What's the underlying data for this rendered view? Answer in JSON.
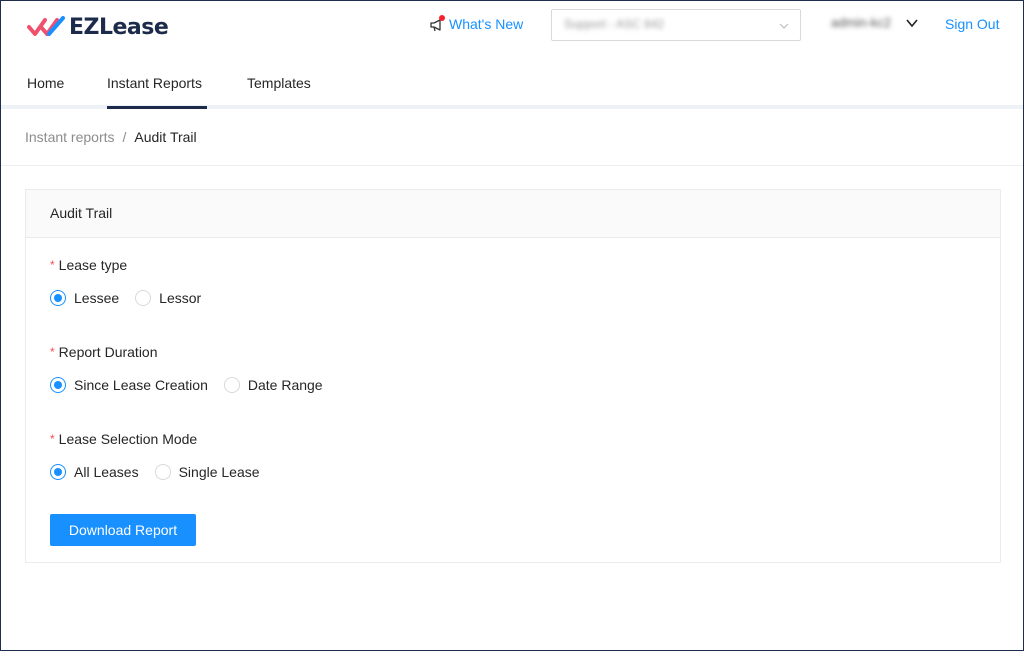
{
  "brand": {
    "name": "EZLease",
    "mark_icon": "double-check-logo-icon",
    "colors": {
      "mark_red": "#f0506e",
      "mark_blue": "#1890ff",
      "text": "#1c2b4a"
    }
  },
  "header": {
    "whats_new_label": "What's New",
    "whats_new_icon": "megaphone-icon",
    "org_select_value": "Support - ASC 842",
    "user_name": "admin-kc2",
    "sign_out_label": "Sign Out"
  },
  "nav": {
    "tabs": [
      {
        "label": "Home",
        "active": false
      },
      {
        "label": "Instant Reports",
        "active": true
      },
      {
        "label": "Templates",
        "active": false
      }
    ]
  },
  "breadcrumb": {
    "parent": "Instant reports",
    "separator": "/",
    "current": "Audit Trail"
  },
  "card": {
    "title": "Audit Trail",
    "fields": [
      {
        "label": "Lease type",
        "required_mark": "*",
        "options": [
          "Lessee",
          "Lessor"
        ],
        "selected": "Lessee"
      },
      {
        "label": "Report Duration",
        "required_mark": "*",
        "options": [
          "Since Lease Creation",
          "Date Range"
        ],
        "selected": "Since Lease Creation"
      },
      {
        "label": "Lease Selection Mode",
        "required_mark": "*",
        "options": [
          "All Leases",
          "Single Lease"
        ],
        "selected": "All Leases"
      }
    ],
    "submit_label": "Download Report"
  },
  "theme": {
    "primary": "#1890ff",
    "required": "#ff4d4f",
    "nav_underline": "#1c2b4a"
  }
}
